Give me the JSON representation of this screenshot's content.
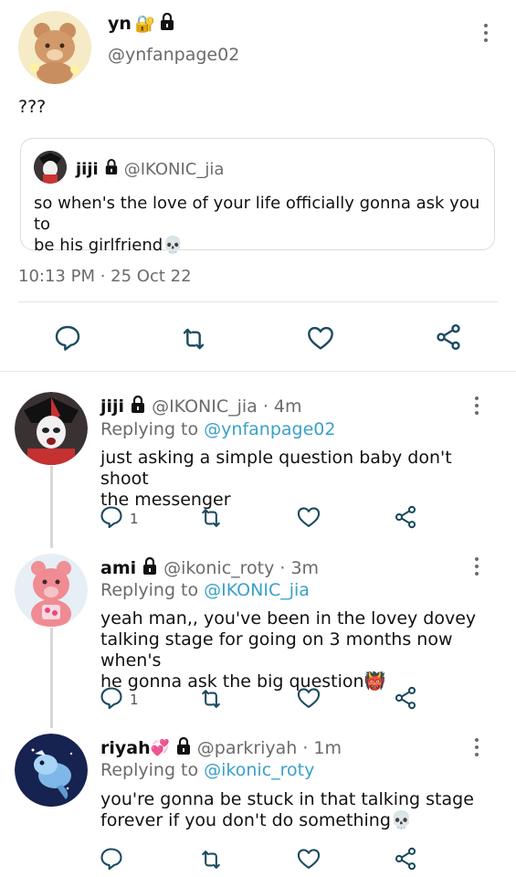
{
  "main_tweet": {
    "name": "yn",
    "name_emoji": "🔐",
    "handle": "@ynfanpage02",
    "text": "???",
    "timestamp": "10:13 PM · 25 Oct 22",
    "quoted": {
      "name": "jiji",
      "handle": "@IKONIC_jia",
      "text_line1": "so when's the love of your life officially gonna ask you to",
      "text_line2": "be his girlfriend",
      "emoji": "💀"
    }
  },
  "replies": [
    {
      "name": "jiji",
      "handle": "@IKONIC_jia",
      "time": "· 4m",
      "replying_label": "Replying to ",
      "replying_to": "@ynfanpage02",
      "lines": [
        "just asking a simple question baby don't shoot",
        "the messenger"
      ],
      "reply_count": "1"
    },
    {
      "name": "ami",
      "handle": "@ikonic_roty",
      "time": "· 3m",
      "replying_label": "Replying to ",
      "replying_to": "@IKONIC_jia",
      "lines": [
        "yeah man,, you've been in the lovey dovey",
        "talking stage for going on 3 months now when's",
        "he gonna ask the big question"
      ],
      "emoji": "👹",
      "reply_count": "1"
    },
    {
      "name": "riyah",
      "name_emoji": "💞",
      "handle": "@parkriyah",
      "time": "· 1m",
      "replying_label": "Replying to ",
      "replying_to": "@ikonic_roty",
      "lines": [
        "you're gonna be stuck in that talking stage",
        "forever if you don't do something"
      ],
      "emoji": "💀",
      "reply_count": ""
    }
  ],
  "icons": {
    "reply": "reply-icon",
    "retweet": "retweet-icon",
    "like": "heart-icon",
    "share": "share-icon",
    "lock": "lock-icon",
    "more": "more-vertical-icon"
  },
  "colors": {
    "link": "#3aa0c8",
    "muted": "#6b6b6b",
    "icon": "#1b4a60"
  }
}
